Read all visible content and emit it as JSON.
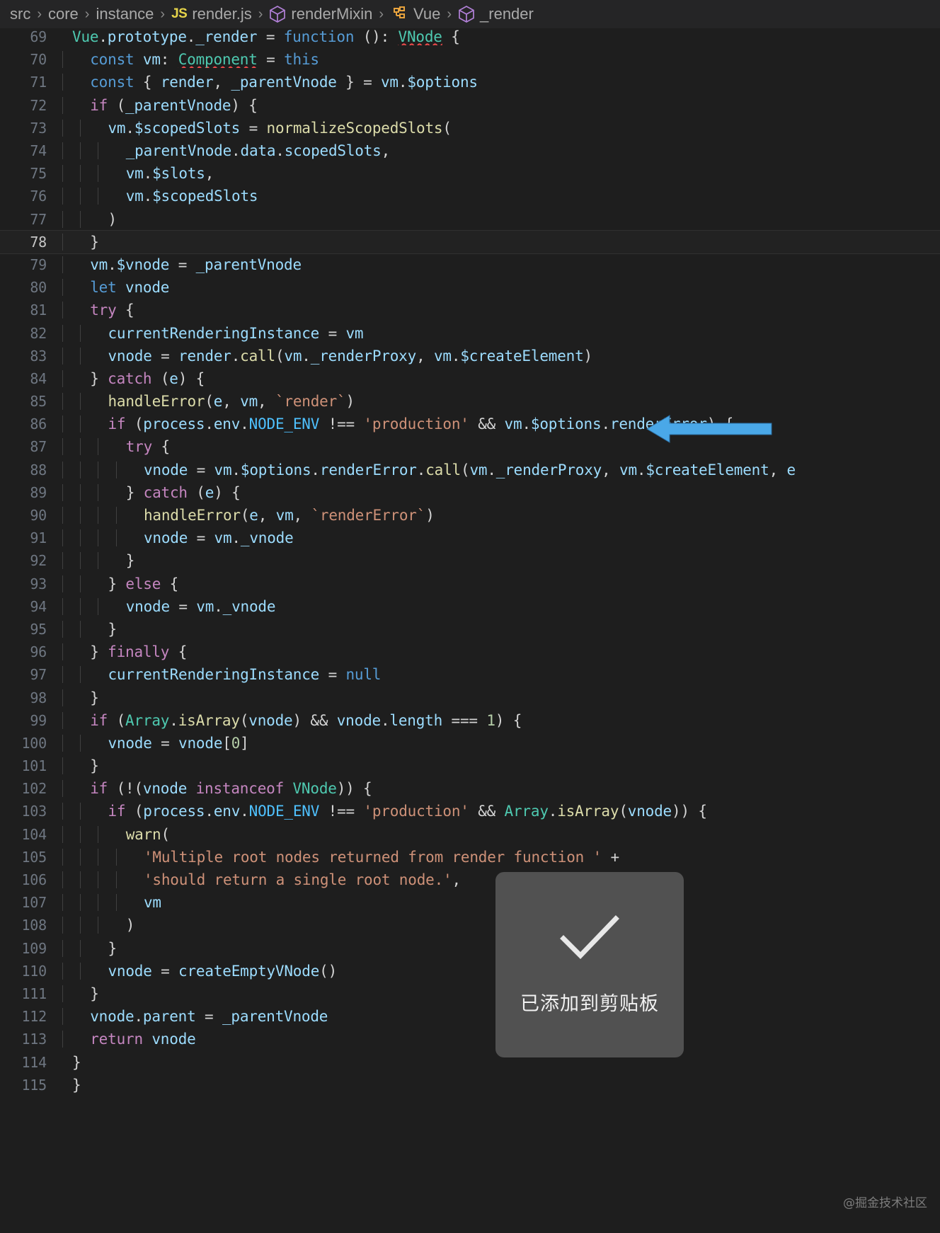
{
  "breadcrumb": {
    "items": [
      {
        "label": "src",
        "icon": ""
      },
      {
        "label": "core",
        "icon": ""
      },
      {
        "label": "instance",
        "icon": ""
      },
      {
        "label": "render.js",
        "icon": "js-file-icon"
      },
      {
        "label": "renderMixin",
        "icon": "method-cube-icon"
      },
      {
        "label": "Vue",
        "icon": "class-icon"
      },
      {
        "label": "_render",
        "icon": "method-cube-icon"
      }
    ],
    "separator": "›"
  },
  "editor": {
    "active_line": 78,
    "first_visible_line": 68,
    "language": "JavaScript",
    "colors": {
      "background": "#1e1e1e",
      "gutter_text": "#6e7681",
      "keyword": "#c586c0",
      "declaration": "#569cd6",
      "variable": "#9cdcfe",
      "function": "#dcdcaa",
      "type": "#4ec9b0",
      "string": "#ce9178",
      "number": "#b5cea8",
      "operator": "#d4d4d4",
      "constant": "#4fc1ff",
      "error_squiggle": "#f14c4c"
    },
    "lines": [
      {
        "n": 69,
        "indent": 0,
        "text": "Vue.prototype._render = function (): VNode {"
      },
      {
        "n": 70,
        "indent": 1,
        "text": "const vm: Component = this"
      },
      {
        "n": 71,
        "indent": 1,
        "text": "const { render, _parentVnode } = vm.$options"
      },
      {
        "n": 72,
        "indent": 1,
        "text": "if (_parentVnode) {"
      },
      {
        "n": 73,
        "indent": 2,
        "text": "vm.$scopedSlots = normalizeScopedSlots("
      },
      {
        "n": 74,
        "indent": 3,
        "text": "_parentVnode.data.scopedSlots,"
      },
      {
        "n": 75,
        "indent": 3,
        "text": "vm.$slots,"
      },
      {
        "n": 76,
        "indent": 3,
        "text": "vm.$scopedSlots"
      },
      {
        "n": 77,
        "indent": 2,
        "text": ")"
      },
      {
        "n": 78,
        "indent": 1,
        "text": "}"
      },
      {
        "n": 79,
        "indent": 1,
        "text": "vm.$vnode = _parentVnode"
      },
      {
        "n": 80,
        "indent": 1,
        "text": "let vnode"
      },
      {
        "n": 81,
        "indent": 1,
        "text": "try {"
      },
      {
        "n": 82,
        "indent": 2,
        "text": "currentRenderingInstance = vm"
      },
      {
        "n": 83,
        "indent": 2,
        "text": "vnode = render.call(vm._renderProxy, vm.$createElement)"
      },
      {
        "n": 84,
        "indent": 1,
        "text": "} catch (e) {"
      },
      {
        "n": 85,
        "indent": 2,
        "text": "handleError(e, vm, `render`)"
      },
      {
        "n": 86,
        "indent": 2,
        "text": "if (process.env.NODE_ENV !== 'production' && vm.$options.renderError) {"
      },
      {
        "n": 87,
        "indent": 3,
        "text": "try {"
      },
      {
        "n": 88,
        "indent": 4,
        "text": "vnode = vm.$options.renderError.call(vm._renderProxy, vm.$createElement, e"
      },
      {
        "n": 89,
        "indent": 3,
        "text": "} catch (e) {"
      },
      {
        "n": 90,
        "indent": 4,
        "text": "handleError(e, vm, `renderError`)"
      },
      {
        "n": 91,
        "indent": 4,
        "text": "vnode = vm._vnode"
      },
      {
        "n": 92,
        "indent": 3,
        "text": "}"
      },
      {
        "n": 93,
        "indent": 2,
        "text": "} else {"
      },
      {
        "n": 94,
        "indent": 3,
        "text": "vnode = vm._vnode"
      },
      {
        "n": 95,
        "indent": 2,
        "text": "}"
      },
      {
        "n": 96,
        "indent": 1,
        "text": "} finally {"
      },
      {
        "n": 97,
        "indent": 2,
        "text": "currentRenderingInstance = null"
      },
      {
        "n": 98,
        "indent": 1,
        "text": "}"
      },
      {
        "n": 99,
        "indent": 1,
        "text": "if (Array.isArray(vnode) && vnode.length === 1) {"
      },
      {
        "n": 100,
        "indent": 2,
        "text": "vnode = vnode[0]"
      },
      {
        "n": 101,
        "indent": 1,
        "text": "}"
      },
      {
        "n": 102,
        "indent": 1,
        "text": "if (!(vnode instanceof VNode)) {"
      },
      {
        "n": 103,
        "indent": 2,
        "text": "if (process.env.NODE_ENV !== 'production' && Array.isArray(vnode)) {"
      },
      {
        "n": 104,
        "indent": 3,
        "text": "warn("
      },
      {
        "n": 105,
        "indent": 4,
        "text": "'Multiple root nodes returned from render function ' +"
      },
      {
        "n": 106,
        "indent": 4,
        "text": "'should return a single root node.',"
      },
      {
        "n": 107,
        "indent": 4,
        "text": "vm"
      },
      {
        "n": 108,
        "indent": 3,
        "text": ")"
      },
      {
        "n": 109,
        "indent": 2,
        "text": "}"
      },
      {
        "n": 110,
        "indent": 2,
        "text": "vnode = createEmptyVNode()"
      },
      {
        "n": 111,
        "indent": 1,
        "text": "}"
      },
      {
        "n": 112,
        "indent": 1,
        "text": "vnode.parent = _parentVnode"
      },
      {
        "n": 113,
        "indent": 1,
        "text": "return vnode"
      },
      {
        "n": 114,
        "indent": 0,
        "text": "}"
      },
      {
        "n": 115,
        "indent": 0,
        "text": "}"
      }
    ]
  },
  "annotation": {
    "arrow": {
      "icon": "left-arrow-annotation",
      "color": "#4aa8e8",
      "points_to_line": 83
    }
  },
  "toast": {
    "icon": "checkmark-icon",
    "message": "已添加到剪贴板",
    "background": "#555555"
  },
  "watermark": {
    "text": "@掘金技术社区"
  }
}
